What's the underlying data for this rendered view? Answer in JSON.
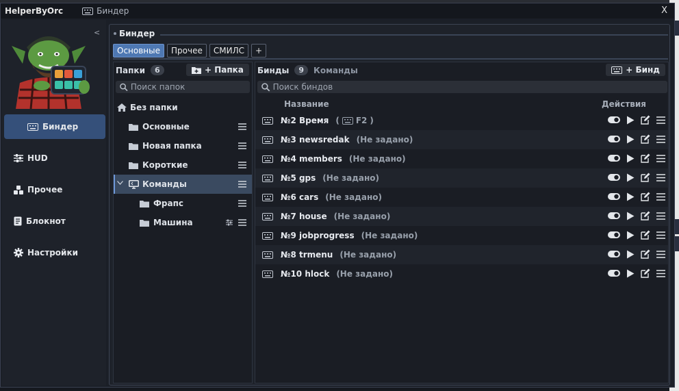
{
  "window": {
    "app_title": "HelperByOrc",
    "tab_title": "Биндер",
    "close_label": "X"
  },
  "sidebar": {
    "collapse_label": "<",
    "items": [
      {
        "label": "Биндер",
        "icon": "keyboard-icon",
        "active": true
      },
      {
        "label": "HUD",
        "icon": "sliders-icon"
      },
      {
        "label": "Прочее",
        "icon": "cubes-icon"
      },
      {
        "label": "Блокнот",
        "icon": "notebook-icon"
      },
      {
        "label": "Настройки",
        "icon": "gear-icon"
      }
    ]
  },
  "section": {
    "title": "Биндер"
  },
  "tabs": [
    {
      "label": "Основные",
      "active": true
    },
    {
      "label": "Прочее"
    },
    {
      "label": "СМИЛС"
    },
    {
      "label": "+"
    }
  ],
  "folders": {
    "header": "Папки",
    "count": "6",
    "add_button": "+ Папка",
    "search_placeholder": "Поиск папок",
    "items": [
      {
        "label": "Без папки",
        "icon": "home-icon"
      },
      {
        "label": "Основные",
        "icon": "folder-icon"
      },
      {
        "label": "Новая папка",
        "icon": "folder-icon"
      },
      {
        "label": "Короткие",
        "icon": "folder-icon"
      },
      {
        "label": "Команды",
        "icon": "monitor-icon",
        "active": true
      },
      {
        "label": "Фрапс",
        "icon": "folder-icon"
      },
      {
        "label": "Машина",
        "icon": "folder-icon"
      }
    ]
  },
  "binds": {
    "header": "Бинды",
    "count": "9",
    "subheader": "Команды",
    "add_button": "+ Бинд",
    "search_placeholder": "Поиск биндов",
    "col_name": "Название",
    "col_actions": "Действия",
    "rows": [
      {
        "name": "№2 Время",
        "key": "F2"
      },
      {
        "name": "№3 newsredak",
        "key": "(Не задано)"
      },
      {
        "name": "№4 members",
        "key": "(Не задано)"
      },
      {
        "name": "№5 gps",
        "key": "(Не задано)"
      },
      {
        "name": "№6 cars",
        "key": "(Не задано)"
      },
      {
        "name": "№7 house",
        "key": "(Не задано)"
      },
      {
        "name": "№9 jobprogress",
        "key": "(Не задано)"
      },
      {
        "name": "№8 trmenu",
        "key": "(Не задано)"
      },
      {
        "name": "№10 hlock",
        "key": "(Не задано)"
      }
    ]
  },
  "colors": {
    "accent": "#4e78b3",
    "nav_active": "#35507a",
    "background": "#1b1f27"
  }
}
